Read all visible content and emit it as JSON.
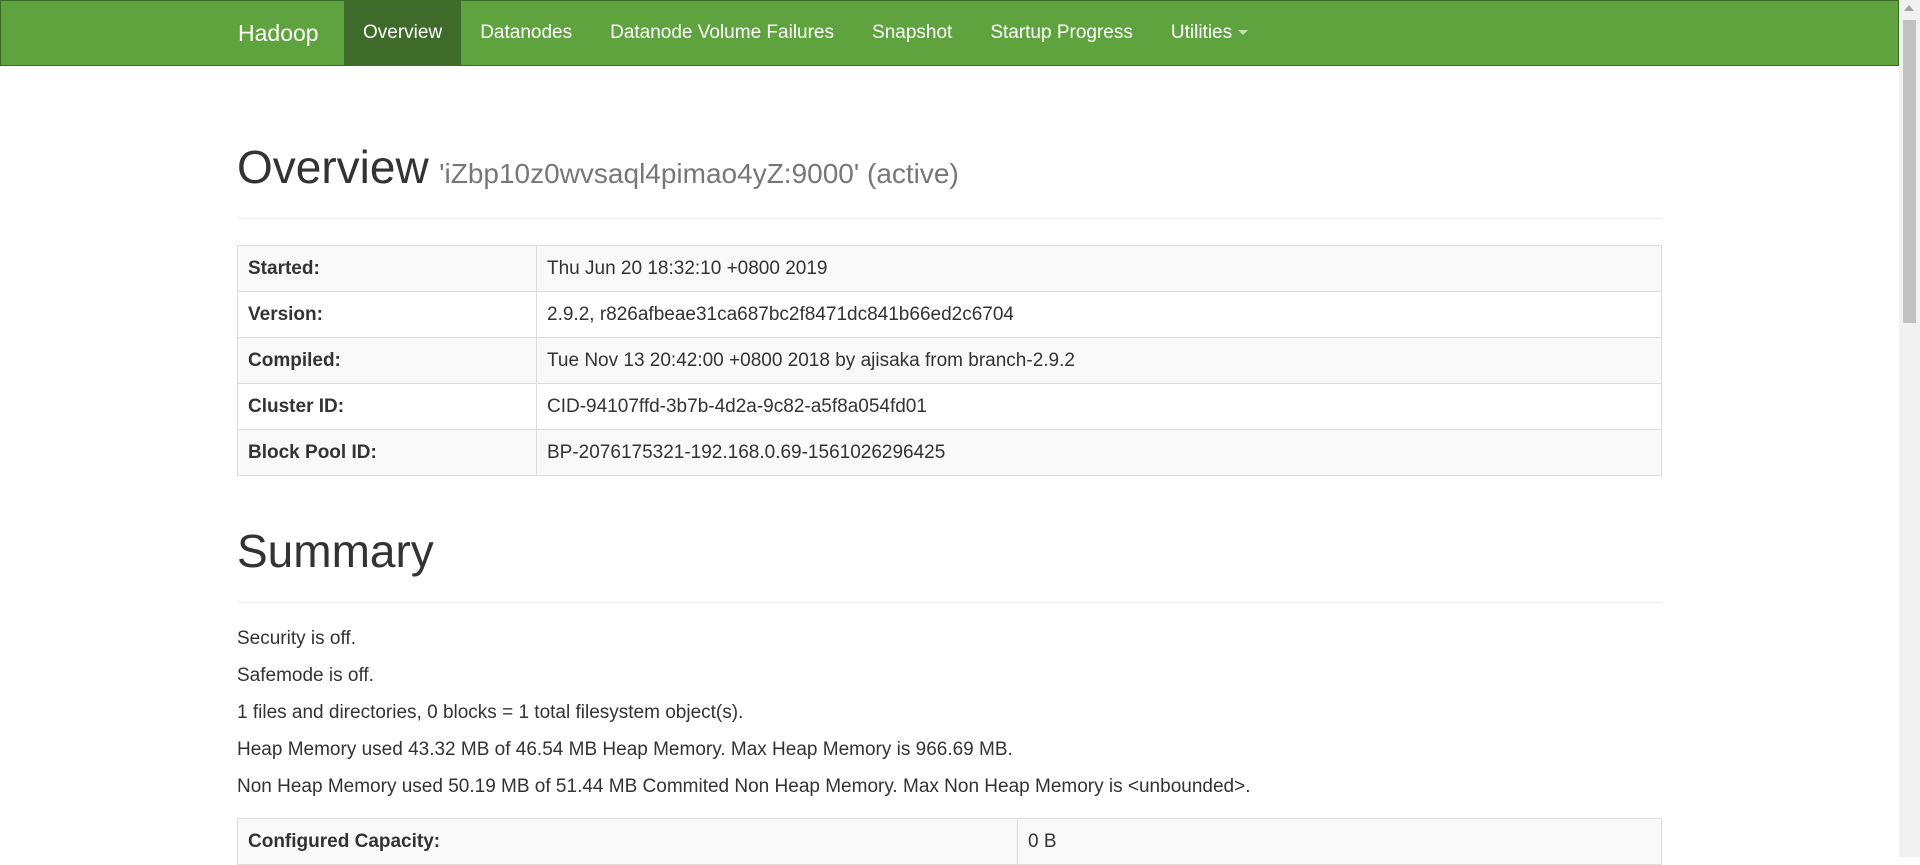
{
  "navbar": {
    "brand": "Hadoop",
    "items": [
      {
        "label": "Overview",
        "active": true
      },
      {
        "label": "Datanodes"
      },
      {
        "label": "Datanode Volume Failures"
      },
      {
        "label": "Snapshot"
      },
      {
        "label": "Startup Progress"
      },
      {
        "label": "Utilities",
        "dropdown": true
      }
    ],
    "color": "#5fa33e",
    "active_color": "#3f6b2a"
  },
  "overview": {
    "title": "Overview",
    "subtitle": "'iZbp10z0wvsaql4pimao4yZ:9000' (active)",
    "rows": [
      {
        "label": "Started:",
        "value": "Thu Jun 20 18:32:10 +0800 2019"
      },
      {
        "label": "Version:",
        "value": "2.9.2, r826afbeae31ca687bc2f8471dc841b66ed2c6704"
      },
      {
        "label": "Compiled:",
        "value": "Tue Nov 13 20:42:00 +0800 2018 by ajisaka from branch-2.9.2"
      },
      {
        "label": "Cluster ID:",
        "value": "CID-94107ffd-3b7b-4d2a-9c82-a5f8a054fd01"
      },
      {
        "label": "Block Pool ID:",
        "value": "BP-2076175321-192.168.0.69-1561026296425"
      }
    ]
  },
  "summary": {
    "title": "Summary",
    "lines": [
      "Security is off.",
      "Safemode is off.",
      "1 files and directories, 0 blocks = 1 total filesystem object(s).",
      "Heap Memory used 43.32 MB of 46.54 MB Heap Memory. Max Heap Memory is 966.69 MB.",
      "Non Heap Memory used 50.19 MB of 51.44 MB Commited Non Heap Memory. Max Non Heap Memory is <unbounded>."
    ],
    "rows": [
      {
        "label": "Configured Capacity:",
        "value": "0 B"
      }
    ]
  }
}
